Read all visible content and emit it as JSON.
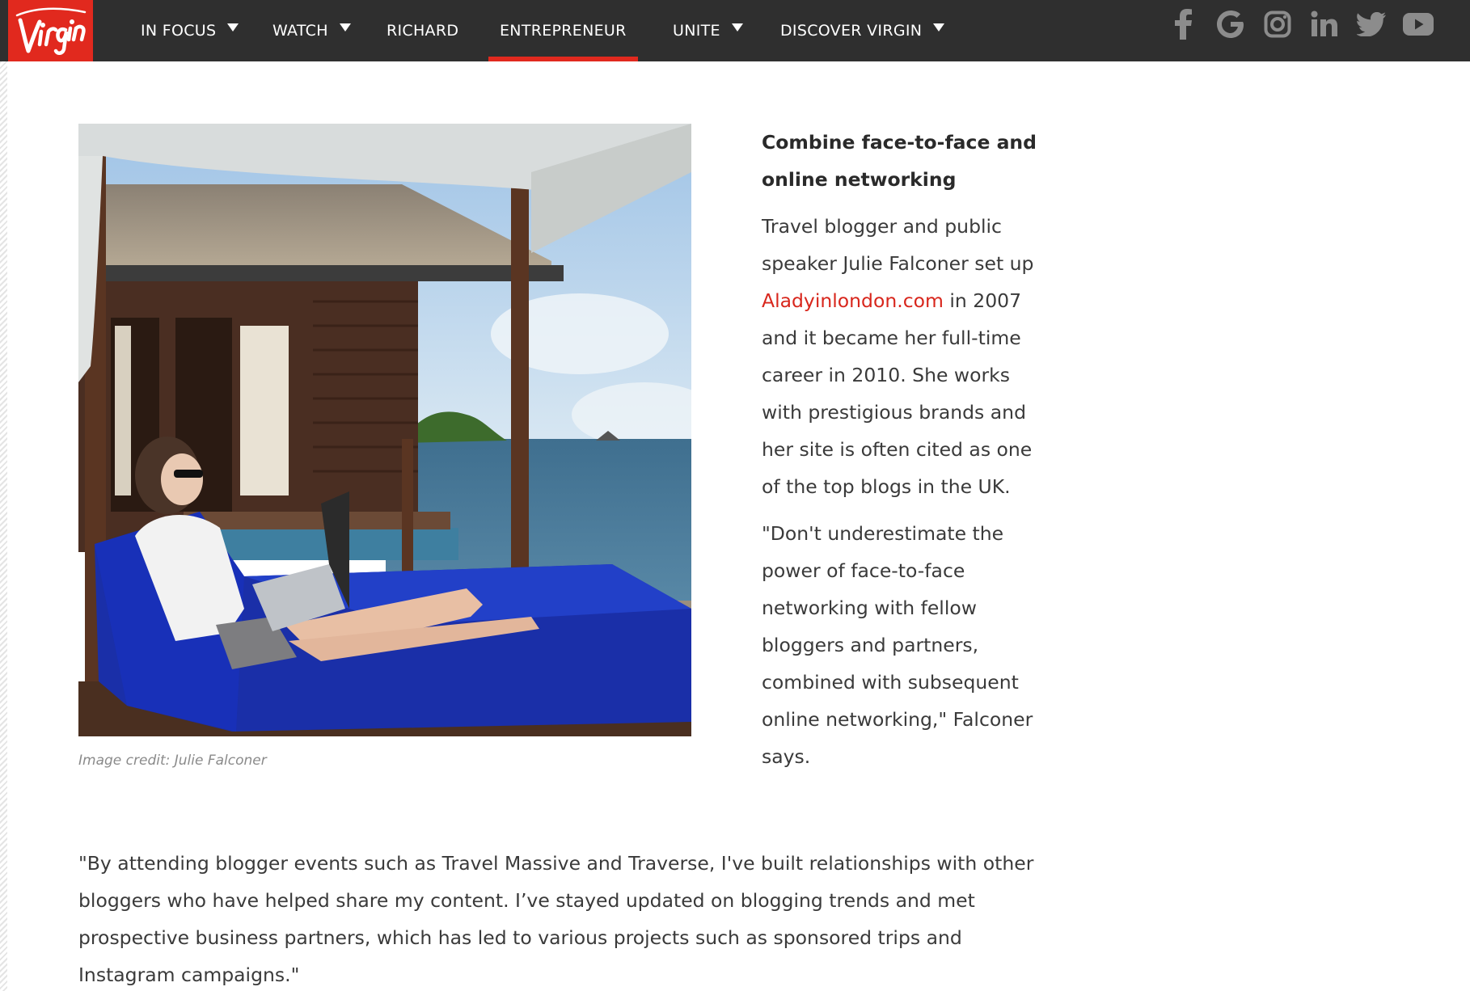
{
  "nav": {
    "logo_text": "Virgin",
    "items": [
      {
        "label": "IN FOCUS",
        "dropdown": true
      },
      {
        "label": "WATCH",
        "dropdown": true
      },
      {
        "label": "RICHARD",
        "dropdown": false
      },
      {
        "label": "ENTREPRENEUR",
        "dropdown": false,
        "active": true
      },
      {
        "label": "UNITE",
        "dropdown": true
      },
      {
        "label": "DISCOVER VIRGIN",
        "dropdown": true
      }
    ],
    "social": [
      "facebook-icon",
      "google-icon",
      "instagram-icon",
      "linkedin-icon",
      "twitter-icon",
      "youtube-icon"
    ]
  },
  "article": {
    "image_caption": "Image credit: Julie Falconer",
    "heading": "Combine face-to-face and online networking",
    "para1_before_link": "Travel blogger and public speaker Julie Falconer set up ",
    "para1_link": "Aladyinlondon.com",
    "para1_after_link": " in 2007 and it became her full-time career in 2010. She works with prestigious brands and her site is often cited as one of the top blogs in the UK.",
    "para2": "\"Don't underestimate the power of face-to-face networking with fellow bloggers and partners, combined with subsequent online networking,\" Falconer says.",
    "para3": "\"By attending blogger events such as Travel Massive and Traverse, I've built relationships with other bloggers who have helped share my content. I’ve stayed updated on blogging trends and met prospective business partners, which has led to various projects such as sponsored trips and Instagram campaigns.\""
  },
  "colors": {
    "nav_bg": "#2f2f2f",
    "brand_red": "#e1291e",
    "link_red": "#d8261c",
    "social_grey": "#8c8c8c"
  }
}
